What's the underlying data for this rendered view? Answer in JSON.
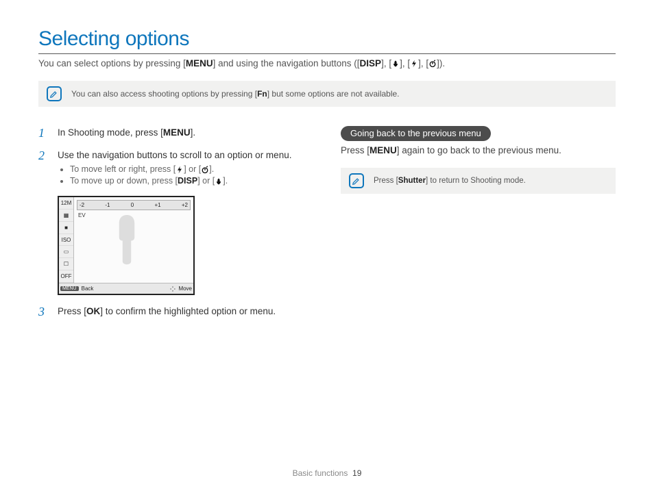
{
  "title": "Selecting options",
  "intro": {
    "pre": "You can select options by pressing [",
    "menu": "MENU",
    "mid": "] and using the navigation buttons ([",
    "disp": "DISP",
    "post": "]).",
    "sep": "], [",
    "icons": [
      "macro",
      "flash",
      "timer"
    ]
  },
  "topnote": {
    "pre": "You can also access shooting options by pressing [",
    "fn": "Fn",
    "post": "] but some options are not available."
  },
  "steps": {
    "s1": {
      "num": "1",
      "pre": "In Shooting mode, press [",
      "btn": "MENU",
      "post": "]."
    },
    "s2": {
      "num": "2",
      "text": "Use the navigation buttons to scroll to an option or menu.",
      "b1": {
        "pre": "To move left or right, press [",
        "mid": "] or [",
        "post": "]."
      },
      "b2": {
        "pre": "To move up or down, press [",
        "disp": "DISP",
        "mid": "] or [",
        "post": "]."
      }
    },
    "s3": {
      "num": "3",
      "pre": "Press [",
      "btn": "OK",
      "post": "] to confirm the highlighted option or menu."
    }
  },
  "lcd": {
    "side": [
      "12M",
      "▦",
      "■",
      "ISO",
      "▭",
      "☐",
      "OFF"
    ],
    "scale": [
      "-2",
      "-1",
      "0",
      "+1",
      "+2"
    ],
    "ev": "EV",
    "back_label": "Back",
    "back_btn": "MENU",
    "move_label": "Move"
  },
  "right": {
    "pill": "Going back to the previous menu",
    "line": {
      "pre": "Press [",
      "btn": "MENU",
      "post": "] again to go back to the previous menu."
    },
    "note": {
      "pre": "Press [",
      "btn": "Shutter",
      "post": "] to return to Shooting mode."
    }
  },
  "footer": {
    "section": "Basic functions",
    "page": "19"
  }
}
